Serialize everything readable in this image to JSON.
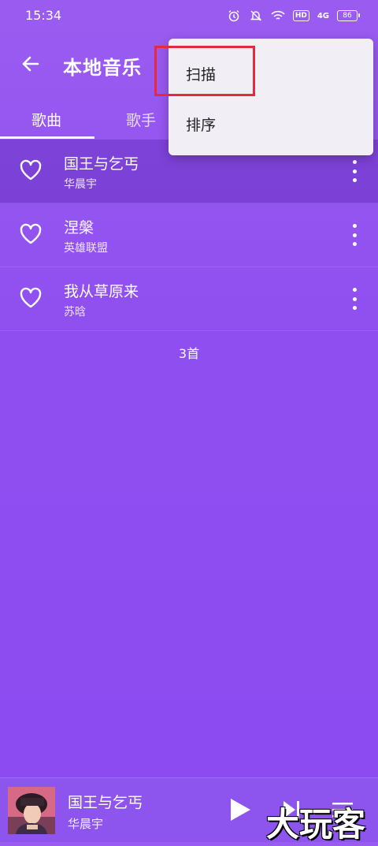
{
  "status_bar": {
    "time": "15:34",
    "network_badge": "HD",
    "signal_label": "4G",
    "battery": "86"
  },
  "header": {
    "title": "本地音乐"
  },
  "tabs": [
    {
      "label": "歌曲",
      "selected": true
    },
    {
      "label": "歌手",
      "selected": false
    }
  ],
  "songs": [
    {
      "title": "国王与乞丐",
      "artist": "华晨宇",
      "active": true
    },
    {
      "title": "涅槃",
      "artist": "英雄联盟",
      "active": false
    },
    {
      "title": "我从草原来",
      "artist": "苏晗",
      "active": false
    }
  ],
  "song_count": "3首",
  "menu": {
    "scan": "扫描",
    "sort": "排序"
  },
  "player": {
    "title": "国王与乞丐",
    "artist": "华晨宇"
  },
  "watermark": "大玩客",
  "colors": {
    "accent": "#8f4ff0",
    "menu_bg": "#f2eef6",
    "highlight": "#e8283c"
  }
}
